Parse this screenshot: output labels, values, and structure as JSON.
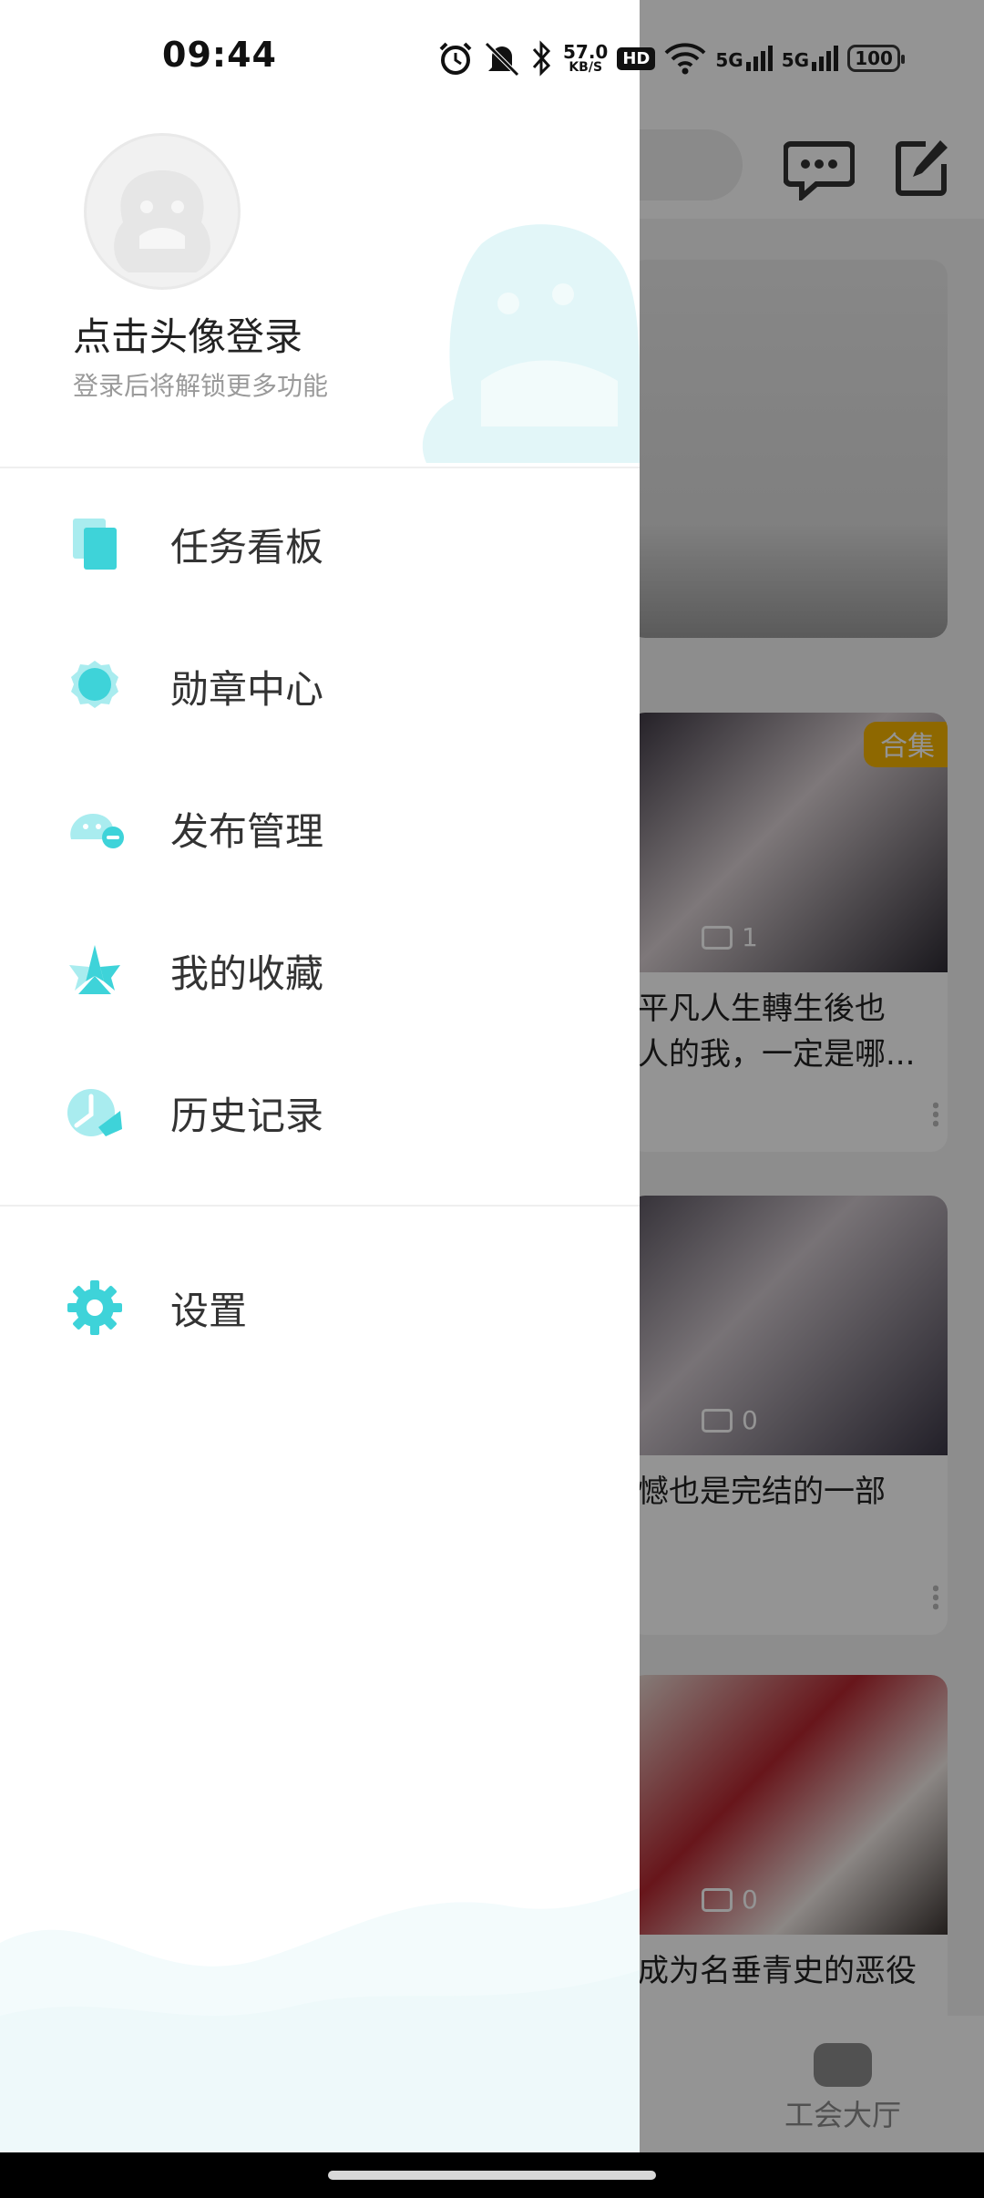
{
  "status_bar": {
    "time": "09:44",
    "net_speed_value": "57.0",
    "net_speed_unit": "KB/S",
    "hd_label": "HD",
    "signal1_label": "5G",
    "signal2_label": "5G",
    "battery": "100"
  },
  "profile": {
    "login_title": "点击头像登录",
    "login_subtitle": "登录后将解锁更多功能"
  },
  "menu": {
    "items": [
      {
        "label": "任务看板",
        "icon": "task-board-icon"
      },
      {
        "label": "勋章中心",
        "icon": "medal-icon"
      },
      {
        "label": "发布管理",
        "icon": "publish-icon"
      },
      {
        "label": "我的收藏",
        "icon": "favorite-star-icon"
      },
      {
        "label": "历史记录",
        "icon": "history-clock-icon"
      }
    ],
    "settings_label": "设置"
  },
  "background": {
    "cards": [
      {
        "badge": "合集",
        "comments": "1",
        "title_line1": "平凡人生轉生後也",
        "title_line2": "人的我，一定是哪..."
      },
      {
        "badge": "",
        "comments": "0",
        "title_line1": "憾也是完结的一部",
        "title_line2": ""
      },
      {
        "badge": "",
        "comments": "0",
        "title_line1": "成为名垂青史的恶役",
        "title_line2": ""
      }
    ],
    "bottom_nav_label": "工会大厅"
  },
  "colors": {
    "accent": "#3ed3d9",
    "accent_light": "#a9ecef",
    "scrim": "rgba(0,0,0,0.42)"
  }
}
